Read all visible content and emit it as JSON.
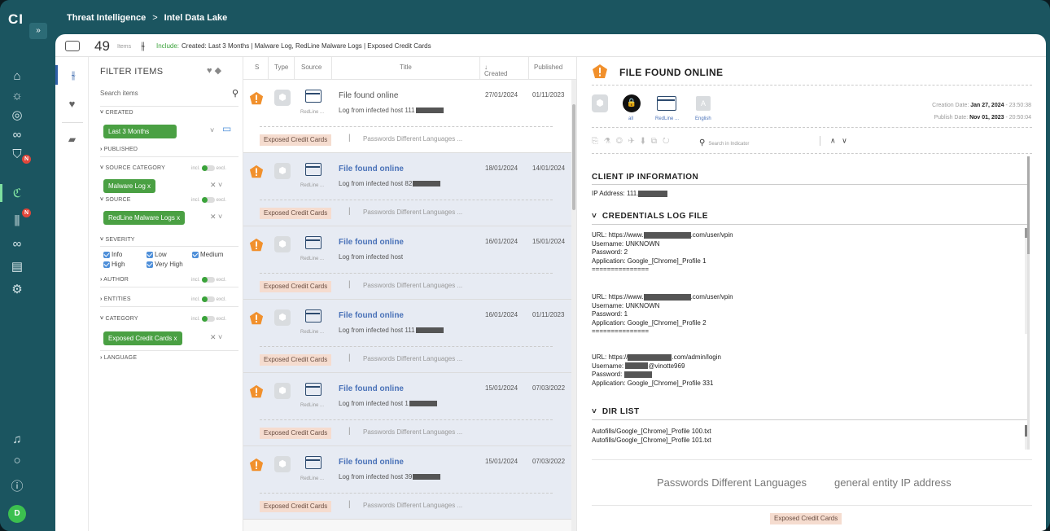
{
  "app": {
    "logo": "CI",
    "expand_glyph": "»",
    "avatar": "D",
    "nav_badge": "N"
  },
  "breadcrumb": {
    "root": "Threat Intelligence",
    "sep": ">",
    "current": "Intel Data Lake"
  },
  "summary": {
    "count": "49",
    "items_label": "Items",
    "include_label": "Include:",
    "include_text": "Created: Last 3 Months | Malware Log, RedLine Malware Logs | Exposed Credit Cards"
  },
  "filters": {
    "title": "FILTER ITEMS",
    "search_placeholder": "Search items",
    "created": "CREATED",
    "created_value": "Last 3 Months",
    "published": "PUBLISHED",
    "source_category": "SOURCE CATEGORY",
    "source_category_chip": "Malware Log",
    "source": "SOURCE",
    "source_chip": "RedLine Malware Logs",
    "severity": "SEVERITY",
    "severity_options": [
      "Info",
      "Low",
      "Medium",
      "High",
      "Very High"
    ],
    "author": "AUTHOR",
    "entities": "ENTITIES",
    "category": "CATEGORY",
    "category_chip": "Exposed Credit Cards",
    "language": "LANGUAGE",
    "incl": "incl.",
    "excl": "excl.",
    "chip_remove": "x"
  },
  "columns": {
    "s": "S",
    "type": "Type",
    "source": "Source",
    "title": "Title",
    "created": "Created",
    "published": "Published"
  },
  "rows": [
    {
      "source": "RedLine ...",
      "title": "File found online",
      "subtitle": "Log from infected host 111",
      "created": "27/01/2024",
      "published": "01/11/2023",
      "tag": "Exposed Credit Cards",
      "tag2": "Passwords Different Languages ..."
    },
    {
      "source": "RedLine ...",
      "title": "File found online",
      "subtitle": "Log from infected host 82",
      "created": "18/01/2024",
      "published": "14/01/2024",
      "tag": "Exposed Credit Cards",
      "tag2": "Passwords Different Languages ..."
    },
    {
      "source": "RedLine ...",
      "title": "File found online",
      "subtitle": "Log from infected host",
      "created": "16/01/2024",
      "published": "15/01/2024",
      "tag": "Exposed Credit Cards",
      "tag2": "Passwords Different Languages ..."
    },
    {
      "source": "RedLine ...",
      "title": "File found online",
      "subtitle": "Log from infected host 111",
      "created": "16/01/2024",
      "published": "01/11/2023",
      "tag": "Exposed Credit Cards",
      "tag2": "Passwords Different Languages ..."
    },
    {
      "source": "RedLine ...",
      "title": "File found online",
      "subtitle": "Log from infected host 1",
      "created": "15/01/2024",
      "published": "07/03/2022",
      "tag": "Exposed Credit Cards",
      "tag2": "Passwords Different Languages ..."
    },
    {
      "source": "RedLine ...",
      "title": "File found online",
      "subtitle": "Log from infected host 39",
      "created": "15/01/2024",
      "published": "07/03/2022",
      "tag": "Exposed Credit Cards",
      "tag2": "Passwords Different Languages ..."
    }
  ],
  "detail": {
    "title": "FILE FOUND ONLINE",
    "badge_all": "all",
    "badge_source": "RedLine ...",
    "badge_lang": "English",
    "creation_label": "Creation Date:",
    "creation_date": "Jan 27, 2024",
    "creation_time": "- 23:50:38",
    "publish_label": "Publish Date:",
    "publish_date": "Nov 01, 2023",
    "publish_time": "- 20:50:04",
    "search_placeholder": "Search in Indicator",
    "client_ip_title": "CLIENT IP INFORMATION",
    "ip_label": "IP Address: 111.",
    "cred_title": "CREDENTIALS LOG FILE",
    "cred1": {
      "url_pre": "URL: https://www.",
      "url_post": ".com/user/vpin",
      "user": "Username: UNKNOWN",
      "pass": "Password: 2",
      "app": "Application: Google_[Chrome]_Profile 1",
      "sep": "==============="
    },
    "cred2": {
      "url_pre": "URL: https://www.",
      "url_post": ".com/user/vpin",
      "user": "Username: UNKNOWN",
      "pass": "Password: 1",
      "app": "Application: Google_[Chrome]_Profile 2",
      "sep": "==============="
    },
    "cred3": {
      "url_pre": "URL: https://",
      "url_post": ".com/admin/login",
      "user_pre": "Username:",
      "user_post": "@vinotte969",
      "pass": "Password:",
      "app": "Application: Google_[Chrome]_Profile 331"
    },
    "dir_title": "DIR LIST",
    "dir1": "Autofills/Google_[Chrome]_Profile 100.txt",
    "dir2": "Autofills/Google_[Chrome]_Profile 101.txt",
    "entity1": "Passwords Different Languages",
    "entity2": "general entity IP address",
    "tag": "Exposed Credit Cards"
  }
}
